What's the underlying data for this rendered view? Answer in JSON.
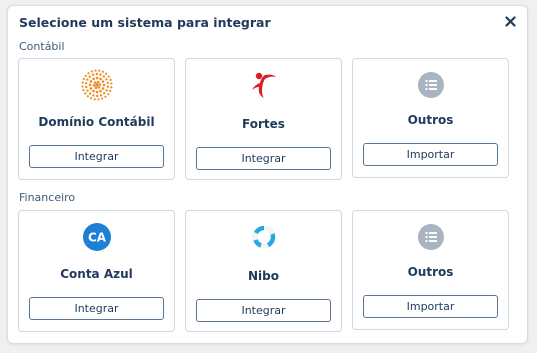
{
  "modal": {
    "title": "Selecione um sistema para integrar",
    "close_icon": "close-icon"
  },
  "sections": [
    {
      "title": "Contábil",
      "cards": [
        {
          "name": "Domínio Contábil",
          "button": "Integrar",
          "logo": "dominio-logo-icon"
        },
        {
          "name": "Fortes",
          "button": "Integrar",
          "logo": "fortes-logo-icon"
        },
        {
          "name": "Outros",
          "button": "Importar",
          "logo": "list-icon"
        }
      ]
    },
    {
      "title": "Financeiro",
      "cards": [
        {
          "name": "Conta Azul",
          "button": "Integrar",
          "logo": "conta-azul-logo-icon",
          "logo_text": "CA"
        },
        {
          "name": "Nibo",
          "button": "Integrar",
          "logo": "nibo-logo-icon"
        },
        {
          "name": "Outros",
          "button": "Importar",
          "logo": "list-icon"
        }
      ]
    }
  ],
  "colors": {
    "title_text": "#1f3a5a",
    "dominio_orange": "#f08a1c",
    "fortes_red": "#d81f26",
    "list_icon_gray": "#a9b4c2",
    "conta_azul_blue": "#1e7fd6",
    "nibo_blue": "#29a8e0"
  }
}
